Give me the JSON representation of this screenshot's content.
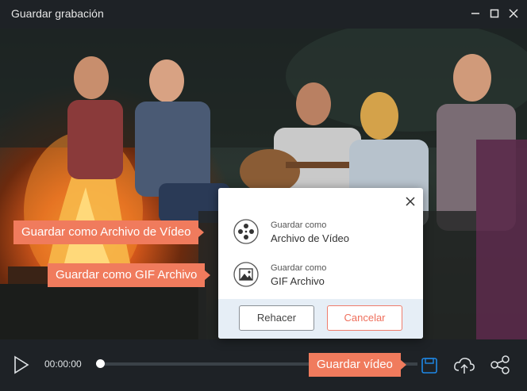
{
  "window": {
    "title": "Guardar grabación",
    "icons": [
      "minimize-icon",
      "maximize-icon",
      "close-icon"
    ]
  },
  "video": {
    "description_icon": "campfire-scene-image"
  },
  "player": {
    "time": "00:00:00",
    "progress": 0.0,
    "icons": [
      "play-icon",
      "save-icon",
      "upload-cloud-icon",
      "share-icon"
    ]
  },
  "save_dialog": {
    "options": [
      {
        "small": "Guardar como",
        "big": "Archivo de Vídeo",
        "icon": "film-reel-icon"
      },
      {
        "small": "Guardar como",
        "big": "GIF Archivo",
        "icon": "gif-image-icon"
      }
    ],
    "redo_label": "Rehacer",
    "cancel_label": "Cancelar"
  },
  "callouts": {
    "video": "Guardar como Archivo de Vídeo",
    "gif": "Guardar como GIF Archivo",
    "save": "Guardar vídeo"
  },
  "colors": {
    "accent": "#f07b5d",
    "progress": "#1e88e5",
    "save_icon": "#1e88e5"
  }
}
